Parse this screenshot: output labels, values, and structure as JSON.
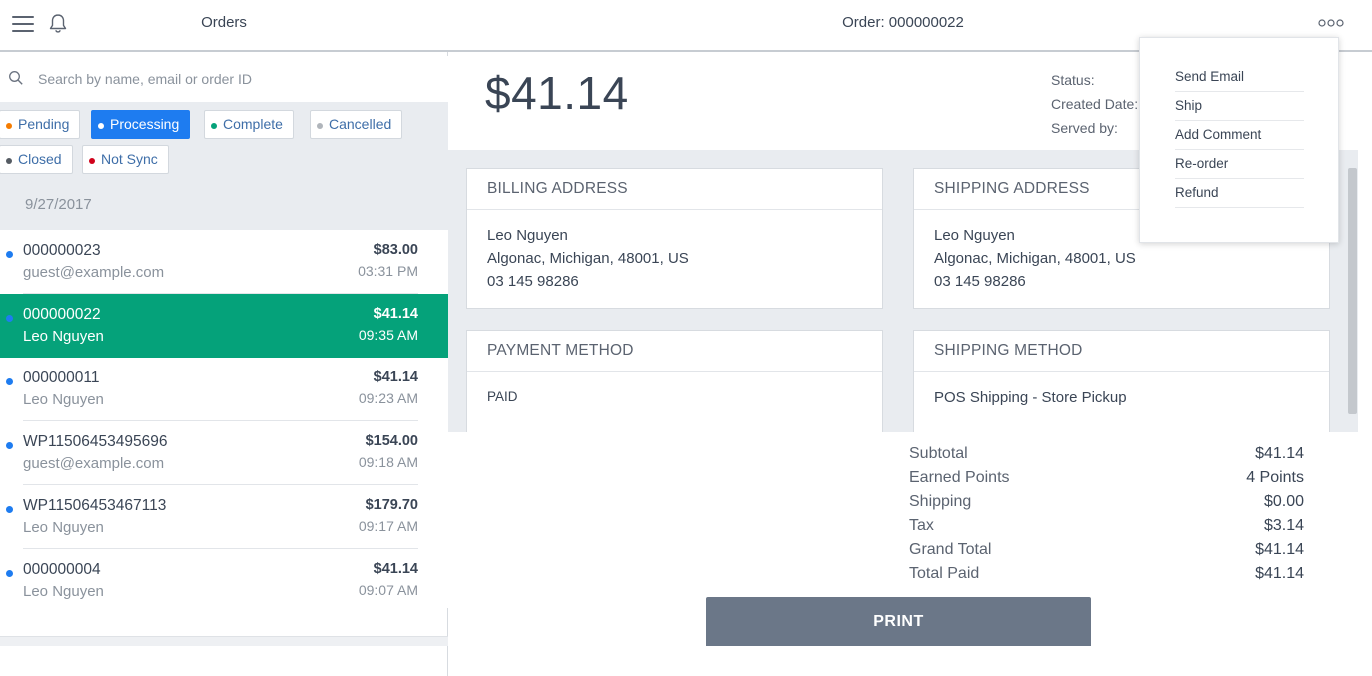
{
  "left_header": {
    "title": "Orders"
  },
  "search": {
    "placeholder": "Search by name, email or order ID",
    "value": ""
  },
  "filters": [
    {
      "label": "Pending",
      "color": "#f57c00",
      "active": false
    },
    {
      "label": "Processing",
      "color": "#ffffff",
      "active": true
    },
    {
      "label": "Complete",
      "color": "#05a27a",
      "active": false
    },
    {
      "label": "Cancelled",
      "color": "#b0b5bb",
      "active": false
    },
    {
      "label": "Closed",
      "color": "#555b63",
      "active": false
    },
    {
      "label": "Not Sync",
      "color": "#d0021b",
      "active": false
    }
  ],
  "order_group": {
    "date": "9/27/2017"
  },
  "orders": [
    {
      "id": "000000023",
      "customer": "guest@example.com",
      "amount": "$83.00",
      "time": "03:31 PM",
      "selected": false
    },
    {
      "id": "000000022",
      "customer": "Leo Nguyen",
      "amount": "$41.14",
      "time": "09:35 AM",
      "selected": true
    },
    {
      "id": "000000011",
      "customer": "Leo Nguyen",
      "amount": "$41.14",
      "time": "09:23 AM",
      "selected": false
    },
    {
      "id": "WP11506453495696",
      "customer": "guest@example.com",
      "amount": "$154.00",
      "time": "09:18 AM",
      "selected": false
    },
    {
      "id": "WP11506453467113",
      "customer": "Leo Nguyen",
      "amount": "$179.70",
      "time": "09:17 AM",
      "selected": false
    },
    {
      "id": "000000004",
      "customer": "Leo Nguyen",
      "amount": "$41.14",
      "time": "09:07 AM",
      "selected": false
    }
  ],
  "order_detail": {
    "title": "Order: 000000022",
    "total": "$41.14",
    "meta_labels": [
      "Status:",
      "Created Date:",
      "Served by:"
    ],
    "billing": {
      "title": "BILLING ADDRESS",
      "name": "Leo Nguyen",
      "address": "Algonac, Michigan, 48001, US",
      "phone": "03 145 98286"
    },
    "shipping": {
      "title": "SHIPPING ADDRESS",
      "name": "Leo Nguyen",
      "address": "Algonac, Michigan, 48001, US",
      "phone": "03 145 98286"
    },
    "payment": {
      "title": "PAYMENT METHOD",
      "value": "PAID"
    },
    "shipping_method": {
      "title": "SHIPPING METHOD",
      "value": "POS Shipping - Store Pickup"
    },
    "totals": [
      {
        "label": "Subtotal",
        "value": "$41.14"
      },
      {
        "label": "Earned Points",
        "value": "4 Points"
      },
      {
        "label": "Shipping",
        "value": "$0.00"
      },
      {
        "label": "Tax",
        "value": "$3.14"
      },
      {
        "label": "Grand Total",
        "value": "$41.14"
      },
      {
        "label": "Total Paid",
        "value": "$41.14"
      }
    ],
    "print_label": "PRINT"
  },
  "action_menu": {
    "items": [
      "Send Email",
      "Ship",
      "Add Comment",
      "Re-order",
      "Refund"
    ]
  },
  "colors": {
    "accent": "#1e7cf0",
    "selected_row": "#05a27a",
    "print_button": "#6b7788",
    "order_bullet": "#1e7cf0"
  }
}
